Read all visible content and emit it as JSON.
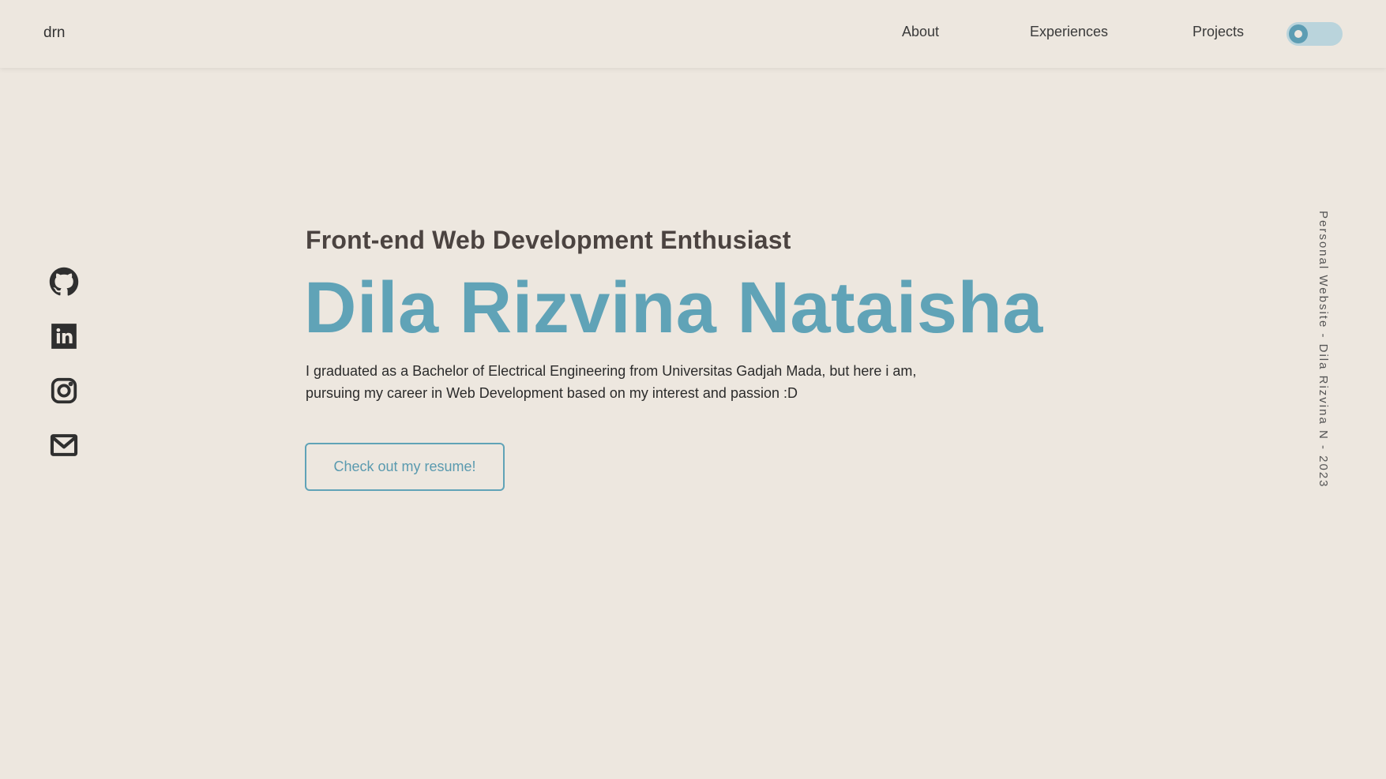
{
  "header": {
    "brand": "drn",
    "nav": [
      {
        "label": "About"
      },
      {
        "label": "Experiences"
      },
      {
        "label": "Projects"
      }
    ],
    "theme_toggle": {
      "state": "off"
    }
  },
  "socials": [
    {
      "icon": "github-icon"
    },
    {
      "icon": "linkedin-icon"
    },
    {
      "icon": "instagram-icon"
    },
    {
      "icon": "mail-icon"
    }
  ],
  "hero": {
    "subtitle": "Front-end Web Development Enthusiast",
    "name": "Dila Rizvina Nataisha",
    "description": "I graduated as a Bachelor of Electrical Engineering from Universitas Gadjah Mada, but here i am, pursuing my career in Web Development based on my interest and passion :D",
    "resume_button": "Check out my resume!"
  },
  "side_text": "Personal Website - Dila Rizvina N - 2023",
  "colors": {
    "background": "#ede7df",
    "accent": "#60a3b7",
    "text": "#2f2f2f"
  }
}
